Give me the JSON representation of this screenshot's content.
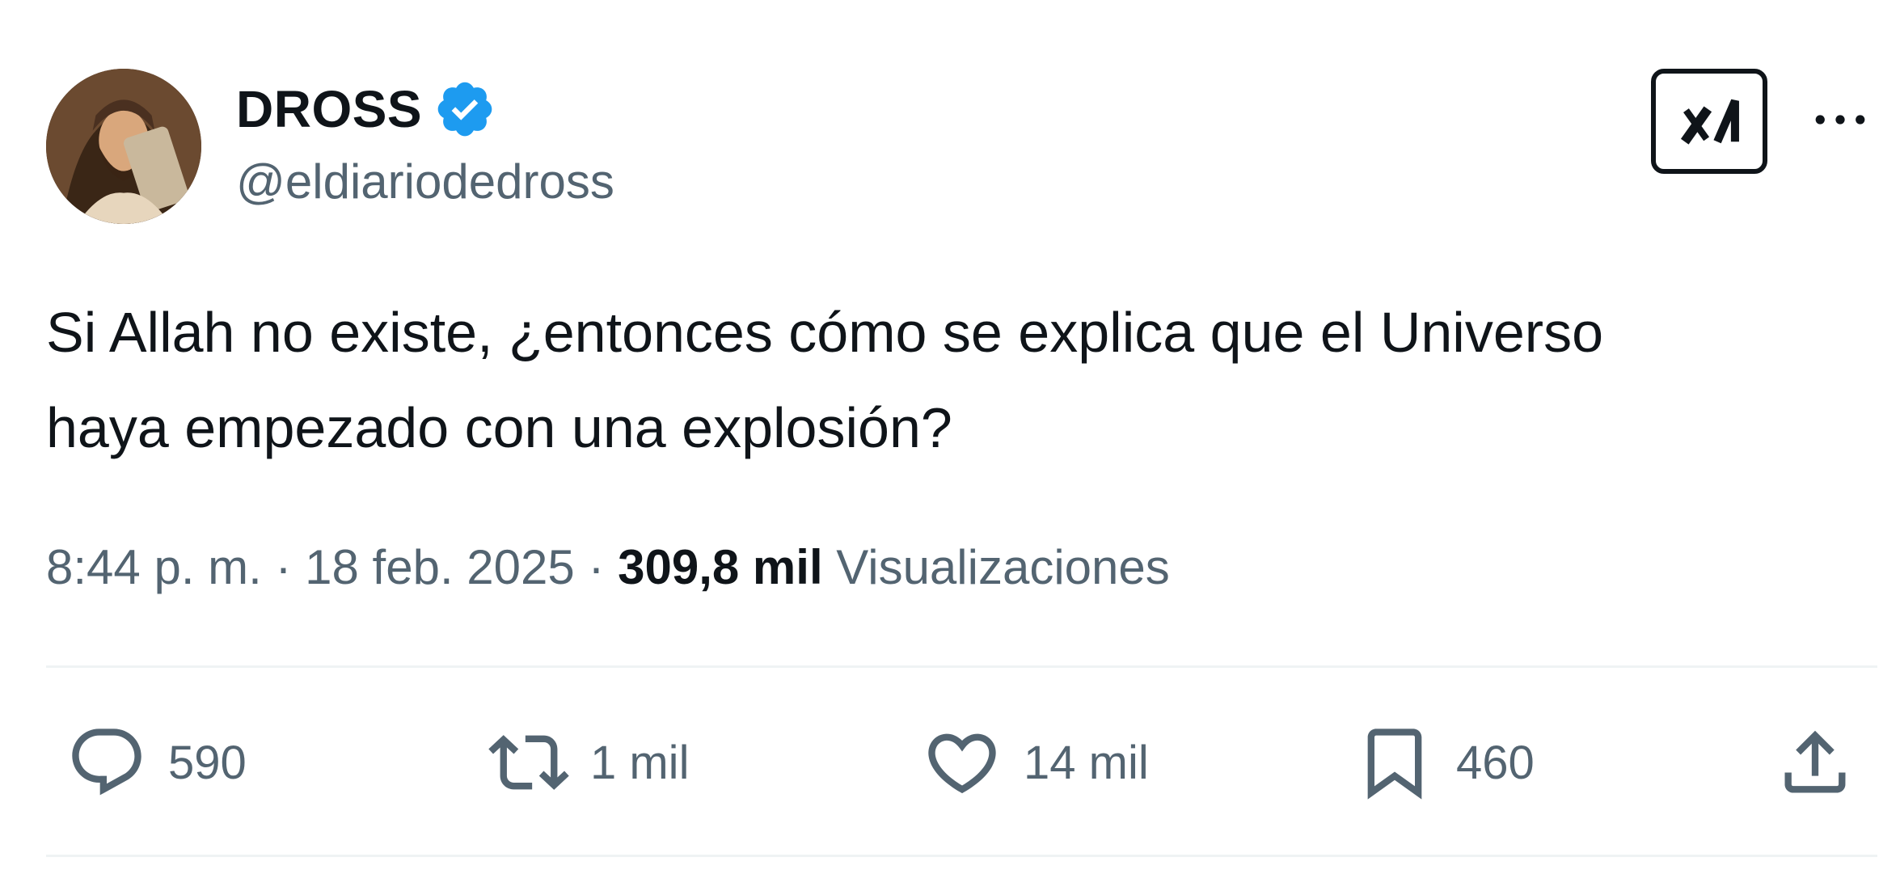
{
  "author": {
    "display_name": "DROSS",
    "handle": "@eldiariodedross",
    "verified": true,
    "verified_color": "#1d9bf0"
  },
  "header": {
    "grok_icon": "grok-icon",
    "more_icon": "more-horizontal-icon"
  },
  "tweet": {
    "text": "Si Allah no existe, ¿entonces cómo se explica que el Universo\nhaya empezado con una explosión?"
  },
  "meta": {
    "time": "8:44 p. m.",
    "separator": "·",
    "date": "18 feb. 2025",
    "views_count": "309,8 mil",
    "views_label": "Visualizaciones"
  },
  "actions": {
    "reply": {
      "icon": "reply-icon",
      "count": "590"
    },
    "retweet": {
      "icon": "retweet-icon",
      "count": "1 mil"
    },
    "like": {
      "icon": "heart-icon",
      "count": "14 mil"
    },
    "bookmark": {
      "icon": "bookmark-icon",
      "count": "460"
    },
    "share": {
      "icon": "share-icon"
    }
  },
  "colors": {
    "text_primary": "#0f1419",
    "text_secondary": "#536471",
    "divider": "#eff3f4"
  }
}
